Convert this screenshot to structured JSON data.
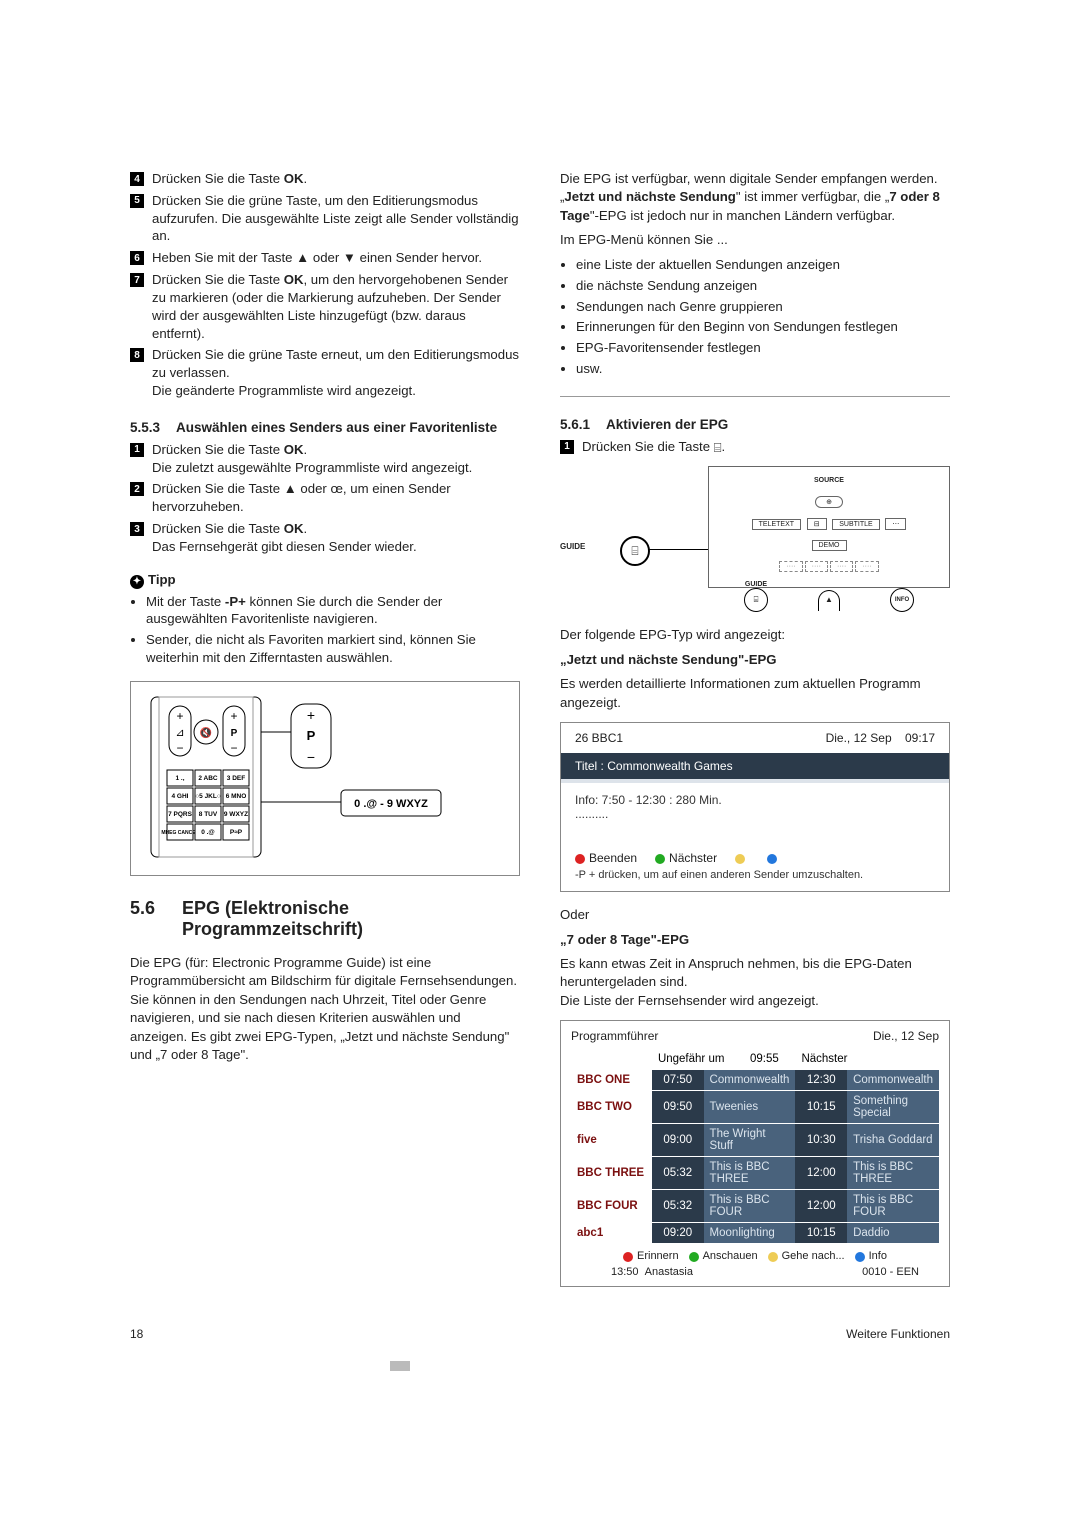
{
  "leftCol": {
    "steps1": [
      {
        "n": "4",
        "text": "Drücken Sie die Taste ",
        "key": "OK",
        "after": "."
      },
      {
        "n": "5",
        "text": "Drücken Sie die grüne Taste, um den Editierungsmodus aufzurufen. Die ausgewählte Liste zeigt alle Sender vollständig an."
      },
      {
        "n": "6",
        "text": "Heben Sie mit der Taste ▲ oder ▼ einen Sender hervor."
      },
      {
        "n": "7",
        "text": "Drücken Sie die Taste ",
        "key": "OK",
        "after": ", um den hervorgehobenen Sender zu markieren (oder die Markierung aufzuheben. Der Sender wird der ausgewählten Liste hinzugefügt (bzw. daraus entfernt)."
      },
      {
        "n": "8",
        "text": "Drücken Sie die grüne Taste erneut, um den Editierungsmodus zu verlassen.\nDie geänderte Programmliste wird angezeigt."
      }
    ],
    "sec553_num": "5.5.3",
    "sec553_title": "Auswählen eines Senders aus einer Favoritenliste",
    "steps2": [
      {
        "n": "1",
        "text": "Drücken Sie die Taste ",
        "key": "OK",
        "after": ".\nDie zuletzt ausgewählte Programmliste wird angezeigt."
      },
      {
        "n": "2",
        "text": "Drücken Sie die Taste ▲ oder œ, um einen Sender hervorzuheben."
      },
      {
        "n": "3",
        "text": "Drücken Sie die Taste ",
        "key": "OK",
        "after": ".\nDas Fernsehgerät gibt diesen Sender wieder."
      }
    ],
    "tipp_label": "Tipp",
    "tipps": [
      "Mit der Taste -P+ können Sie durch die Sender der ausgewählten Favoritenliste navigieren.",
      "Sender, die nicht als Favoriten markiert sind, können Sie weiterhin mit den Zifferntasten auswählen."
    ],
    "remote_keys": {
      "r1": [
        "1 .,",
        "2 ABC",
        "3 DEF"
      ],
      "r2": [
        "4 GHI",
        "5 JKL",
        "6 MNO"
      ],
      "r3": [
        "7 PQRS",
        "8 TUV",
        "9 WXYZ"
      ],
      "r4": [
        "MHEG CANCEL",
        "0 .@",
        "P≈P"
      ],
      "big": "0 .@ - 9 WXYZ"
    },
    "sec56_num": "5.6",
    "sec56_title": "EPG (Elektronische Programmzeitschrift)",
    "sec56_body": "Die EPG (für: Electronic Programme Guide) ist eine Programmübersicht am Bildschirm für digitale Fernsehsendungen. Sie können in den Sendungen nach Uhrzeit, Titel oder Genre navigieren, und sie nach diesen Kriterien auswählen und anzeigen. Es gibt zwei EPG-Typen, „Jetzt und nächste Sendung\" und „7 oder 8 Tage\"."
  },
  "rightCol": {
    "intro1": "Die EPG ist verfügbar, wenn digitale Sender empfangen werden. „",
    "intro_bold1": "Jetzt und nächste Sendung",
    "intro2": "\" ist immer verfügbar, die „",
    "intro_bold2": "7 oder 8 Tage",
    "intro3": "\"-EPG ist jedoch nur in manchen Ländern verfügbar.",
    "menu_lead": "Im EPG-Menü können Sie ...",
    "menu": [
      "eine Liste der aktuellen Sendungen anzeigen",
      "die nächste Sendung anzeigen",
      "Sendungen nach Genre gruppieren",
      "Erinnerungen für den Beginn von Sendungen festlegen",
      "EPG-Favoritensender festlegen",
      "usw."
    ],
    "sec561_num": "5.6.1",
    "sec561_title": "Aktivieren der EPG",
    "step1_text": "Drücken Sie die Taste ",
    "guide_label": "GUIDE",
    "panel": {
      "source": "SOURCE",
      "teletext": "TELETEXT",
      "subtitle": "SUBTITLE",
      "demo": "DEMO",
      "guide": "GUIDE",
      "info": "INFO"
    },
    "after_fig": "Der folgende EPG-Typ wird angezeigt:",
    "now_head": "„Jetzt und nächste Sendung\"-EPG",
    "now_sub": "Es werden detaillierte Informationen zum aktuellen Programm angezeigt.",
    "epg1": {
      "ch": "26  BBC1",
      "date": "Die., 12 Sep",
      "time": "09:17",
      "title": "Titel : Commonwealth Games",
      "info": "Info: 7:50 - 12:30 : 280 Min.",
      "dots": "..........",
      "btn1": "Beenden",
      "btn2": "Nächster",
      "hint": "-P + drücken, um auf einen anderen Sender umzuschalten."
    },
    "oder": "Oder",
    "seven_head": "„7 oder 8 Tage\"-EPG",
    "seven_sub": "Es kann etwas Zeit in Anspruch nehmen, bis die EPG-Daten heruntergeladen sind.\nDie Liste der Fernsehsender wird angezeigt.",
    "epg2": {
      "head_left": "Programmführer",
      "head_right": "Die., 12 Sep",
      "col1": "Ungefähr um",
      "col1t": "09:55",
      "col2": "Nächster",
      "rows": [
        {
          "ch": "BBC ONE",
          "t": "07:50",
          "p": "Commonwealth",
          "t2": "12:30",
          "p2": "Commonwealth"
        },
        {
          "ch": "BBC TWO",
          "t": "09:50",
          "p": "Tweenies",
          "t2": "10:15",
          "p2": "Something Special"
        },
        {
          "ch": "five",
          "t": "09:00",
          "p": "The Wright Stuff",
          "t2": "10:30",
          "p2": "Trisha Goddard"
        },
        {
          "ch": "BBC THREE",
          "t": "05:32",
          "p": "This is BBC THREE",
          "t2": "12:00",
          "p2": "This is BBC THREE"
        },
        {
          "ch": "BBC FOUR",
          "t": "05:32",
          "p": "This is BBC FOUR",
          "t2": "12:00",
          "p2": "This is BBC FOUR"
        },
        {
          "ch": "abc1",
          "t": "09:20",
          "p": "Moonlighting",
          "t2": "10:15",
          "p2": "Daddio"
        }
      ],
      "foot_btns": [
        "Erinnern",
        "Anschauen",
        "Gehe nach...",
        "Info"
      ],
      "foot_left_t": "13:50",
      "foot_left_p": "Anastasia",
      "foot_right": "0010 - EEN"
    }
  },
  "footer": {
    "page": "18",
    "section": "Weitere Funktionen"
  }
}
